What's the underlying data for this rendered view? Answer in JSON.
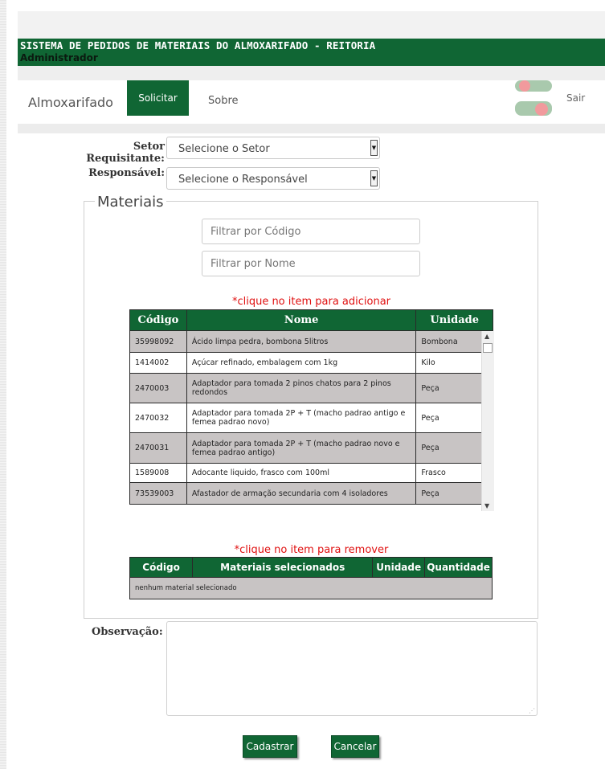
{
  "header": {
    "system_title": "SISTEMA DE PEDIDOS DE MATERIAIS DO ALMOXARIFADO - REITORIA",
    "user_role": "Administrador"
  },
  "nav": {
    "brand": "Almoxarifado",
    "solicitar": "Solicitar",
    "sobre": "Sobre",
    "sair": "Sair"
  },
  "form": {
    "setor_label": "Setor Requisitante:",
    "setor_value": "Selecione o Setor",
    "responsavel_label": "Responsável:",
    "responsavel_value": "Selecione o Responsável"
  },
  "materiais": {
    "legend": "Materiais",
    "filter_codigo_placeholder": "Filtrar por Código",
    "filter_nome_placeholder": "Filtrar por Nome",
    "add_hint": "*clique no item para adicionar",
    "columns": [
      "Código",
      "Nome",
      "Unidade"
    ],
    "rows": [
      {
        "codigo": "35998092",
        "nome": "Ácido limpa pedra, bombona 5litros",
        "unidade": "Bombona"
      },
      {
        "codigo": "1414002",
        "nome": "Açúcar refinado, embalagem com 1kg",
        "unidade": "Kilo"
      },
      {
        "codigo": "2470003",
        "nome": "Adaptador para tomada 2 pinos chatos para 2 pinos redondos",
        "unidade": "Peça"
      },
      {
        "codigo": "2470032",
        "nome": "Adaptador para tomada 2P + T (macho padrao antigo e femea padrao novo)",
        "unidade": "Peça"
      },
      {
        "codigo": "2470031",
        "nome": "Adaptador para tomada 2P + T (macho padrao novo e femea padrao antigo)",
        "unidade": "Peça"
      },
      {
        "codigo": "1589008",
        "nome": "Adocante liquido, frasco com 100ml",
        "unidade": "Frasco"
      },
      {
        "codigo": "73539003",
        "nome": "Afastador de armação secundaria com 4 isoladores",
        "unidade": "Peça"
      }
    ]
  },
  "selecionados": {
    "remove_hint": "*clique no item para remover",
    "columns": [
      "Código",
      "Materiais selecionados",
      "Unidade",
      "Quantidade"
    ],
    "empty_text": "nenhum material selecionado"
  },
  "observacao": {
    "label": "Observação:",
    "value": ""
  },
  "actions": {
    "cadastrar": "Cadastrar",
    "cancelar": "Cancelar"
  },
  "colors": {
    "brand_green": "#106634",
    "hint_red": "#e01010",
    "row_gray": "#c8c4c4"
  }
}
